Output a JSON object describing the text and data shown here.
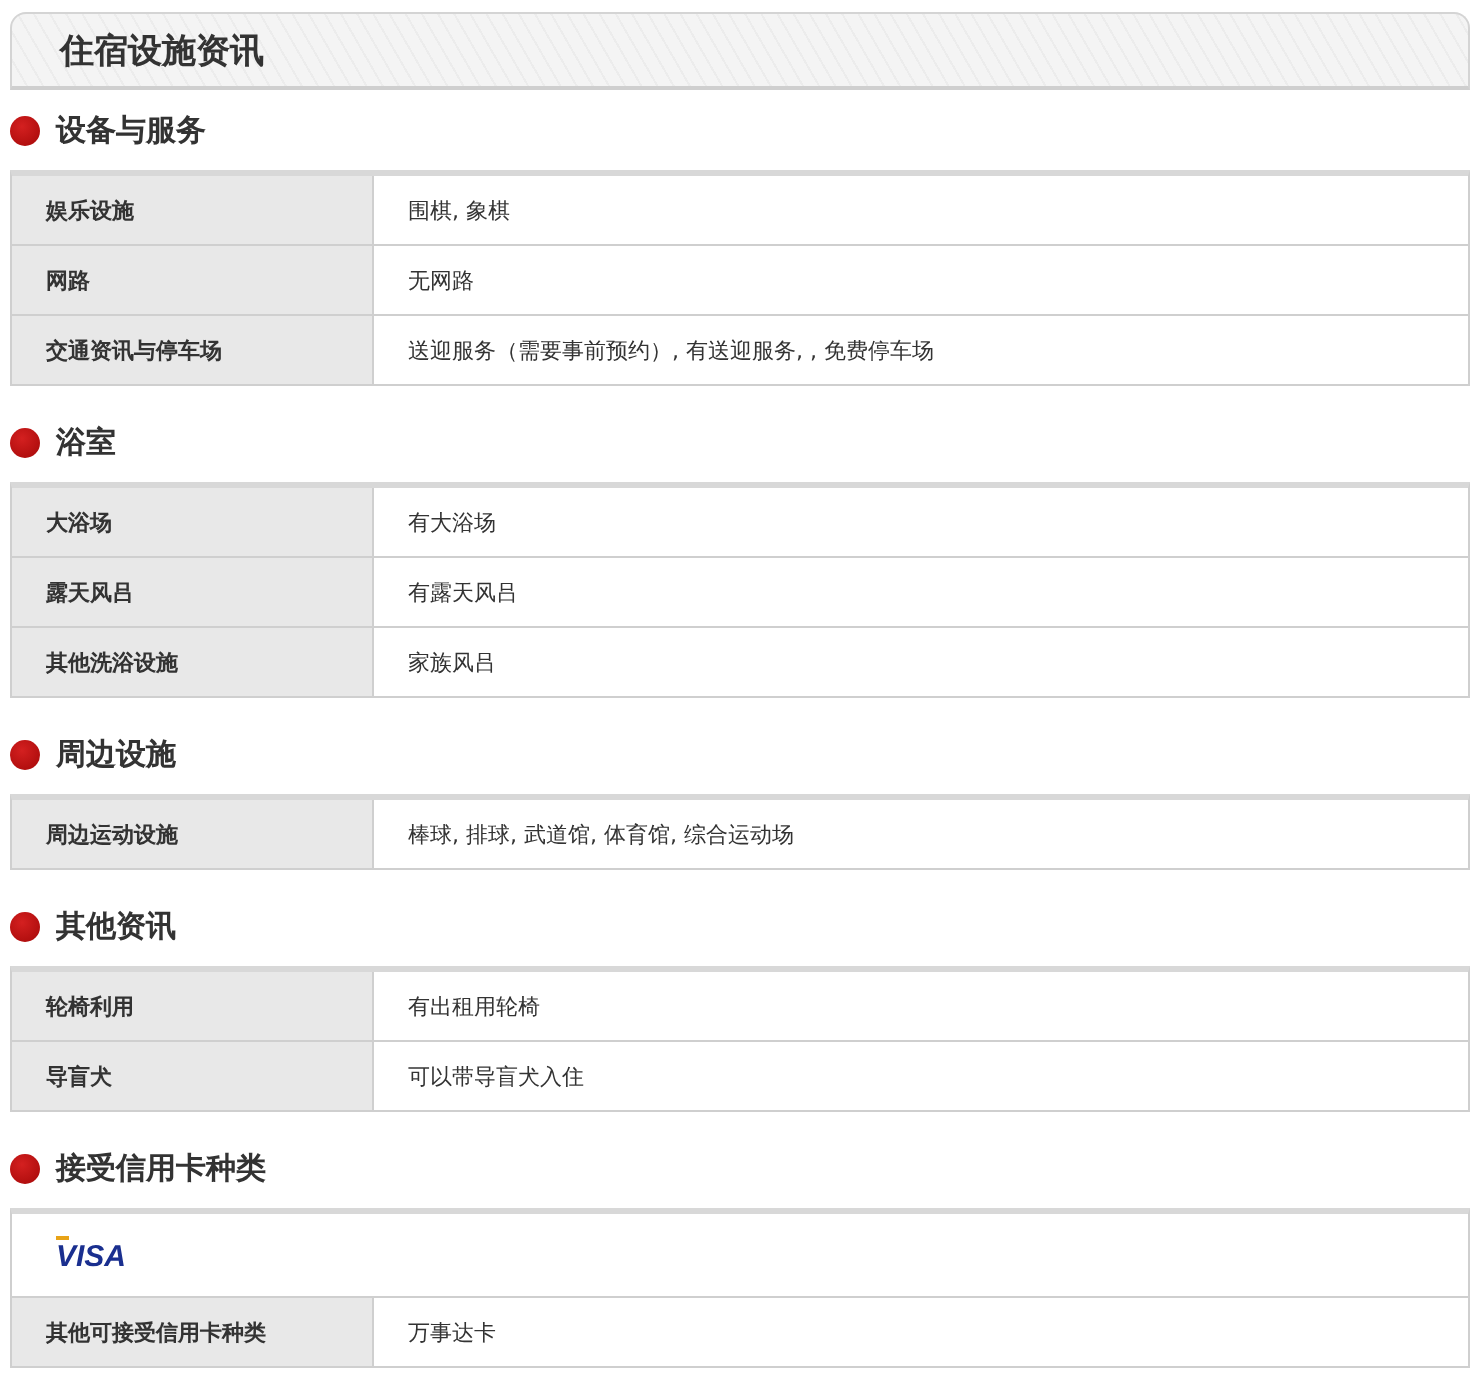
{
  "title": "住宿设施资讯",
  "sections": [
    {
      "heading": "设备与服务",
      "rows": [
        {
          "kind": "pair",
          "label": "娱乐设施",
          "value": "围棋, 象棋"
        },
        {
          "kind": "pair",
          "label": "网路",
          "value": "无网路"
        },
        {
          "kind": "pair",
          "label": "交通资讯与停车场",
          "value": "送迎服务（需要事前预约）, 有送迎服务, , 免费停车场"
        }
      ]
    },
    {
      "heading": "浴室",
      "rows": [
        {
          "kind": "pair",
          "label": "大浴场",
          "value": "有大浴场"
        },
        {
          "kind": "pair",
          "label": "露天风吕",
          "value": "有露天风吕"
        },
        {
          "kind": "pair",
          "label": "其他洗浴设施",
          "value": "家族风吕"
        }
      ]
    },
    {
      "heading": "周边设施",
      "rows": [
        {
          "kind": "pair",
          "label": "周边运动设施",
          "value": "棒球, 排球, 武道馆, 体育馆, 综合运动场"
        }
      ]
    },
    {
      "heading": "其他资讯",
      "rows": [
        {
          "kind": "pair",
          "label": "轮椅利用",
          "value": "有出租用轮椅"
        },
        {
          "kind": "pair",
          "label": "导盲犬",
          "value": "可以带导盲犬入住"
        }
      ]
    },
    {
      "heading": "接受信用卡种类",
      "rows": [
        {
          "kind": "logo",
          "value": "VISA"
        },
        {
          "kind": "pair",
          "label": "其他可接受信用卡种类",
          "value": "万事达卡"
        }
      ]
    }
  ]
}
